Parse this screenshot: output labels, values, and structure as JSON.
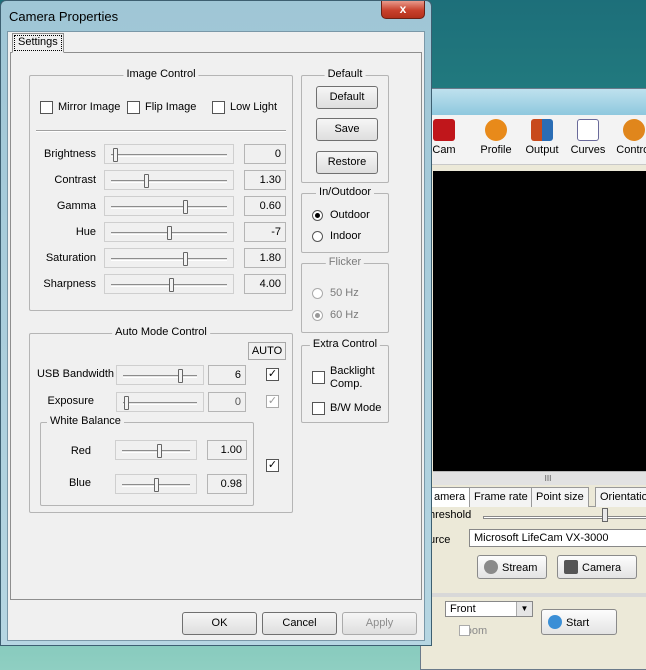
{
  "dialog": {
    "title": "Camera Properties",
    "close_glyph": "x",
    "tab": "Settings",
    "image_control": {
      "title": "Image Control",
      "checks": [
        {
          "label": "Mirror Image",
          "checked": false
        },
        {
          "label": "Flip Image",
          "checked": false
        },
        {
          "label": "Low Light",
          "checked": false
        }
      ],
      "sliders": [
        {
          "label": "Brightness",
          "value": "0",
          "pos": 0.02
        },
        {
          "label": "Contrast",
          "value": "1.30",
          "pos": 0.3
        },
        {
          "label": "Gamma",
          "value": "0.60",
          "pos": 0.65
        },
        {
          "label": "Hue",
          "value": "-7",
          "pos": 0.5
        },
        {
          "label": "Saturation",
          "value": "1.80",
          "pos": 0.65
        },
        {
          "label": "Sharpness",
          "value": "4.00",
          "pos": 0.52
        }
      ]
    },
    "default_group": {
      "title": "Default",
      "buttons": [
        "Default",
        "Save",
        "Restore"
      ]
    },
    "in_outdoor": {
      "title": "In/Outdoor",
      "options": [
        "Outdoor",
        "Indoor"
      ],
      "selected": "Outdoor"
    },
    "flicker": {
      "title": "Flicker",
      "options": [
        "50 Hz",
        "60 Hz"
      ],
      "selected": "60 Hz",
      "enabled": false
    },
    "extra_control": {
      "title": "Extra Control",
      "checks": [
        {
          "label": "Backlight Comp.",
          "checked": false
        },
        {
          "label": "B/W Mode",
          "checked": false
        }
      ]
    },
    "auto_mode": {
      "title": "Auto Mode Control",
      "auto_header": "AUTO",
      "sliders": [
        {
          "label": "USB Bandwidth",
          "value": "6",
          "pos": 0.8,
          "auto": true,
          "auto_enabled": true
        },
        {
          "label": "Exposure",
          "value": "0",
          "pos": 0.02,
          "auto": true,
          "auto_enabled": false
        }
      ],
      "white_balance": {
        "title": "White Balance",
        "sliders": [
          {
            "label": "Red",
            "value": "1.00",
            "pos": 0.55
          },
          {
            "label": "Blue",
            "value": "0.98",
            "pos": 0.5
          }
        ],
        "auto": true
      }
    },
    "footer": {
      "ok": "OK",
      "cancel": "Cancel",
      "apply": "Apply"
    }
  },
  "background_app": {
    "toolbar": [
      {
        "label": "Cam",
        "icon": "camera-icon",
        "color": "#c0161b"
      },
      {
        "label": "Profile",
        "icon": "profile-icon",
        "color": "#e88a1a"
      },
      {
        "label": "Output",
        "icon": "output-icon",
        "color": "#c84a1c"
      },
      {
        "label": "Curves",
        "icon": "curves-icon",
        "color": "#6a6a9a"
      },
      {
        "label": "Control",
        "icon": "control-icon",
        "color": "#e0861c"
      }
    ],
    "scroll_grip": "III",
    "tabs": [
      "amera",
      "Frame rate",
      "Point size",
      "Orientation"
    ],
    "threshold_label": "hreshold",
    "source_label": "urce",
    "source_value": "Microsoft LifeCam VX-3000",
    "stream_button": "Stream",
    "camera_button": "Camera",
    "front_select": "Front",
    "zoom_label": "Zoom",
    "start_button": "Start"
  }
}
